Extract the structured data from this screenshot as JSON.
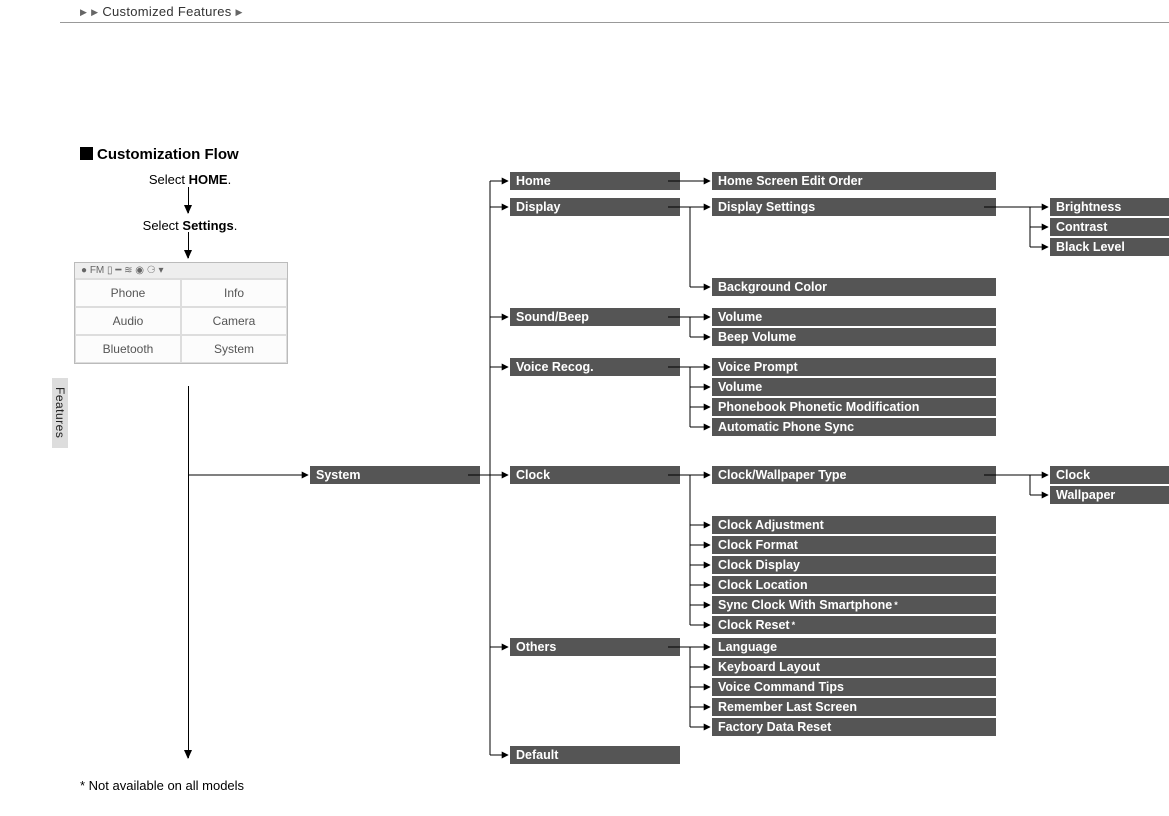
{
  "breadcrumb": "Customized Features",
  "sideTab": "Features",
  "sectionTitle": "Customization Flow",
  "step1_pre": "Select ",
  "step1_bold": "HOME",
  "step1_post": ".",
  "step2_pre": "Select  ",
  "step2_bold": "Settings",
  "step2_post": ".",
  "screenshot": {
    "header": "●  FM   ▯ ━         ≋ ◉ ⚆ ▾",
    "cells": [
      "Phone",
      "Info",
      "Audio",
      "Camera",
      "Bluetooth",
      "System"
    ]
  },
  "footnote": "*  Not available on all models",
  "nodes": {
    "system": "System",
    "home": "Home",
    "display": "Display",
    "soundbeep": "Sound/Beep",
    "voicerecog": "Voice Recog.",
    "clock": "Clock",
    "others": "Others",
    "default": "Default",
    "homeScreenEditOrder": "Home Screen Edit Order",
    "displaySettings": "Display Settings",
    "backgroundColor": "Background Color",
    "volume1": "Volume",
    "beepVolume": "Beep Volume",
    "voicePrompt": "Voice Prompt",
    "volume2": "Volume",
    "phonebookPhonetic": "Phonebook Phonetic Modification",
    "autoPhoneSync": "Automatic Phone Sync",
    "clockWallpaperType": "Clock/Wallpaper Type",
    "clockAdjustment": "Clock Adjustment",
    "clockFormat": "Clock   Format",
    "clockDisplay": "Clock   Display",
    "clockLocation": "Clock Location",
    "syncClockSmartphone": "Sync Clock With Smartphone",
    "clockReset": "Clock Reset",
    "language": "Language",
    "keyboardLayout": "Keyboard Layout",
    "voiceCommandTips": "Voice Command Tips",
    "rememberLastScreen": "Remember Last Screen",
    "factoryDataReset": "Factory Data Reset",
    "brightness": "Brightness",
    "contrast": "Contrast",
    "blackLevel": "Black Level",
    "clock4": "Clock",
    "wallpaper": "Wallpaper",
    "star": "*"
  }
}
